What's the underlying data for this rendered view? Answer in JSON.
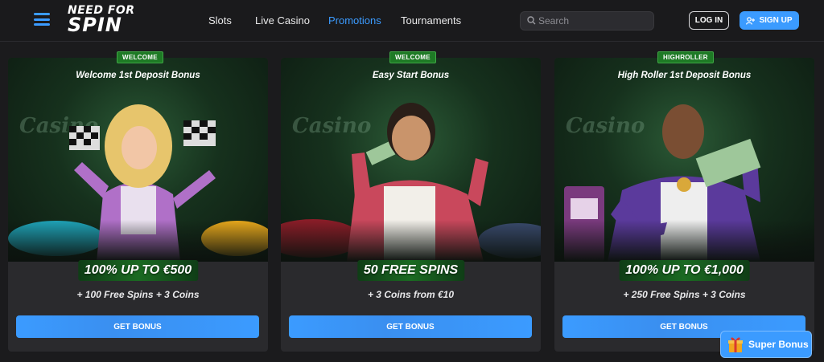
{
  "header": {
    "logo_line1": "NEED FOR",
    "logo_line2": "SPIN",
    "nav": [
      {
        "label": "Slots",
        "active": false
      },
      {
        "label": "Live Casino",
        "active": false
      },
      {
        "label": "Promotions",
        "active": true
      },
      {
        "label": "Tournaments",
        "active": false
      }
    ],
    "search": {
      "placeholder": "Search",
      "value": ""
    },
    "login_label": "LOG IN",
    "signup_label": "SIGN UP"
  },
  "cards": [
    {
      "tag": "WELCOME",
      "title": "Welcome 1st Deposit Bonus",
      "headline": "100% UP TO €500",
      "sub": "+ 100 Free Spins + 3 Coins",
      "button": "GET BONUS"
    },
    {
      "tag": "WELCOME",
      "title": "Easy Start Bonus",
      "headline": "50 FREE SPINS",
      "sub": "+ 3 Coins from €10",
      "button": "GET BONUS"
    },
    {
      "tag": "HIGHROLLER",
      "title": "High Roller 1st Deposit Bonus",
      "headline": "100% UP TO €1,000",
      "sub": "+ 250 Free Spins + 3 Coins",
      "button": "GET BONUS"
    }
  ],
  "art": {
    "background_text": "Casino"
  },
  "super_bonus": {
    "label": "Super Bonus"
  },
  "colors": {
    "accent": "#3b9bff",
    "tag_green": "#1e7a25",
    "card_bg": "#2a2a2d",
    "page_bg": "#1b1b1d"
  }
}
